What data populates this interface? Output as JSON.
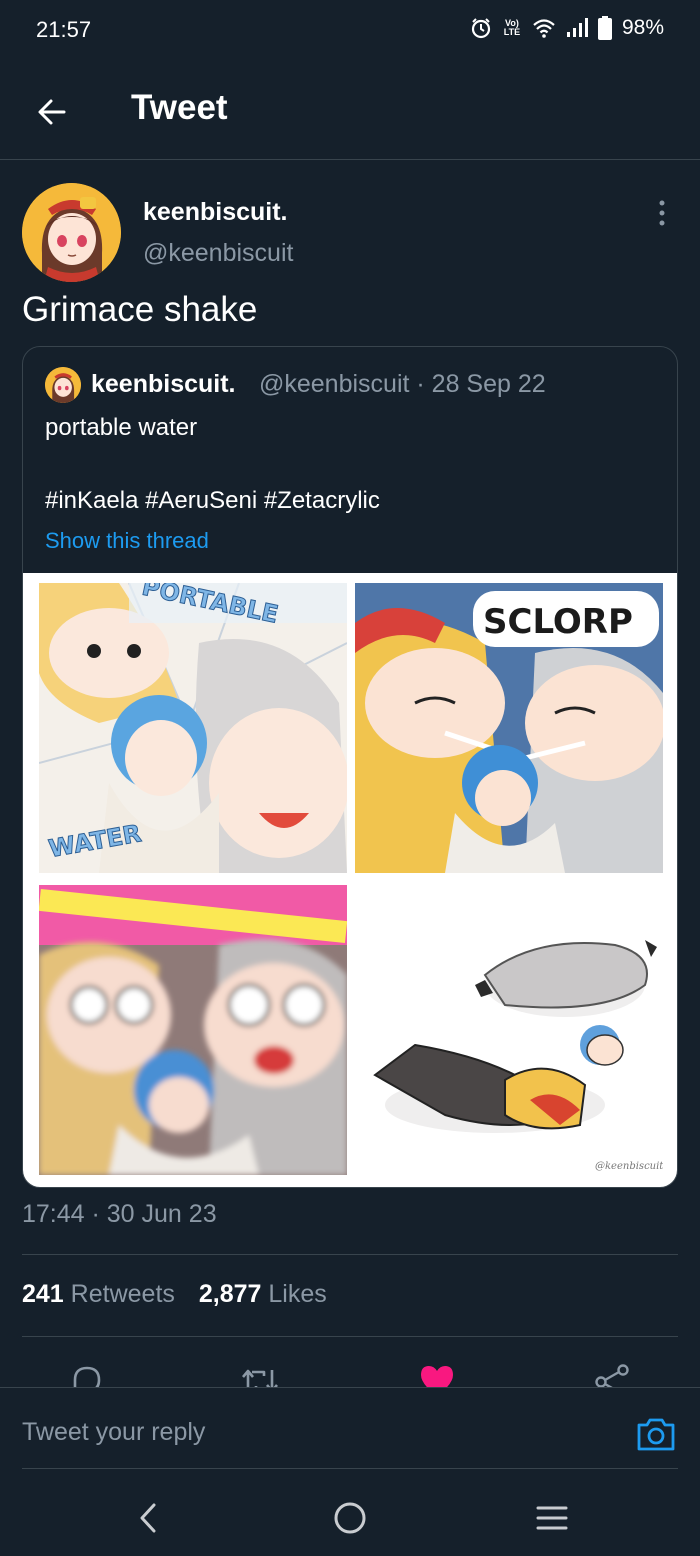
{
  "status_bar": {
    "time": "21:57",
    "battery": "98%",
    "network_label": "Vo) LTE"
  },
  "header": {
    "title": "Tweet"
  },
  "tweet": {
    "author_name": "keenbiscuit.",
    "author_handle": "@keenbiscuit",
    "text": "Grimace shake",
    "timestamp": "17:44 · 30 Jun 23",
    "retweets_count": "241",
    "retweets_label": "Retweets",
    "likes_count": "2,877",
    "likes_label": "Likes",
    "liked": true
  },
  "quoted_tweet": {
    "author_name": "keenbiscuit.",
    "meta": "@keenbiscuit · 28 Sep 22",
    "text_line1": "portable water",
    "text_line2": "#inKaela #AeruSeni #Zetacrylic",
    "show_thread_label": "Show this thread",
    "panel_texts": [
      "PORTABLE",
      "WATER",
      "SCLORP"
    ],
    "watermark": "@keenbiscuit"
  },
  "reply_bar": {
    "placeholder": "Tweet your reply"
  },
  "colors": {
    "background": "#15202b",
    "border": "#38444d",
    "secondary_text": "#8b98a5",
    "link": "#1d9bf0",
    "like": "#f91880"
  },
  "icons": [
    "back-arrow-icon",
    "more-vertical-icon",
    "reply-icon",
    "retweet-icon",
    "heart-icon",
    "share-icon",
    "camera-icon",
    "nav-back-icon",
    "nav-home-icon",
    "nav-recents-icon"
  ]
}
